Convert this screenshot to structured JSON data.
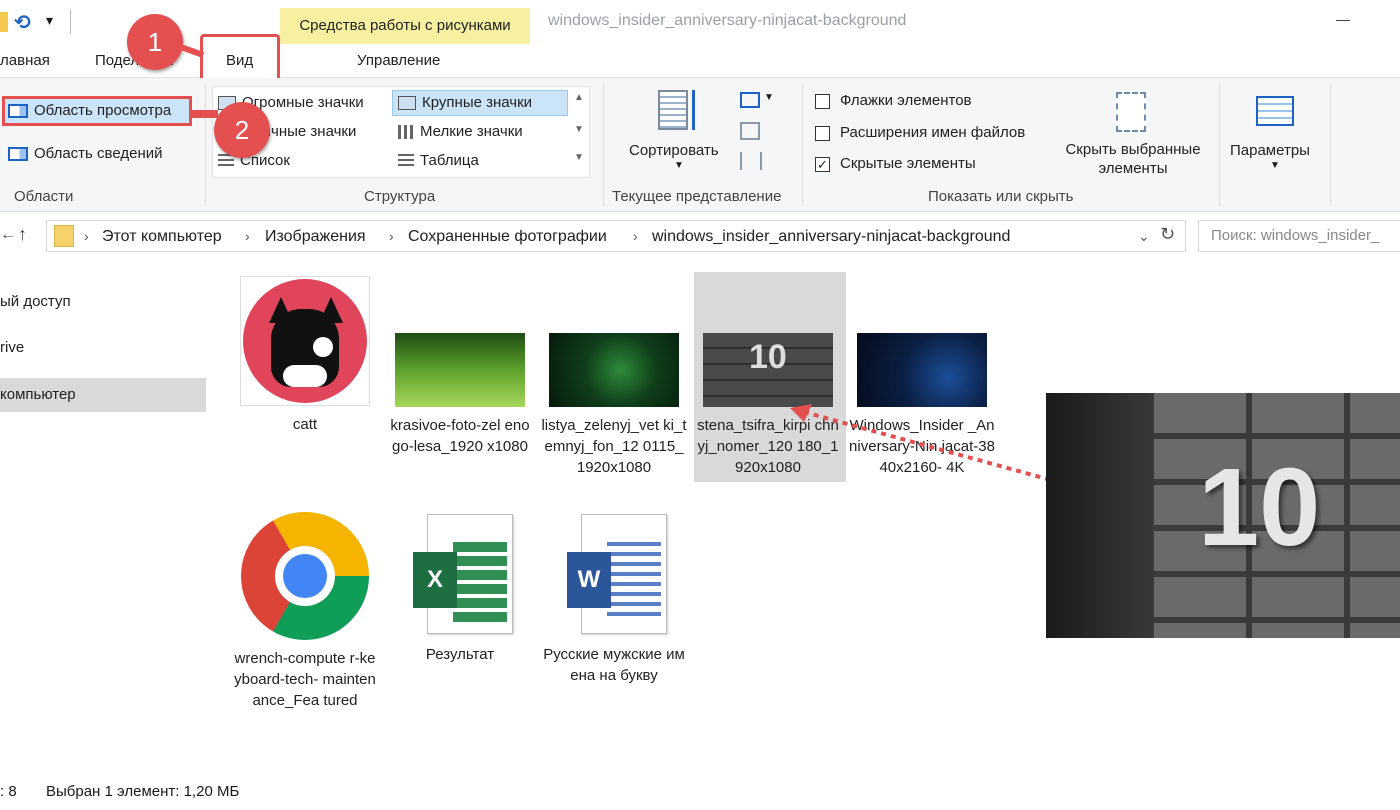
{
  "titlebar": {
    "context_tab": "Средства работы с рисунками",
    "window_title": "windows_insider_anniversary-ninjacat-background"
  },
  "tabs": {
    "home": "лавная",
    "share": "Подел   ться",
    "view": "Вид",
    "manage": "Управление"
  },
  "ribbon": {
    "panes": {
      "preview": "Область просмотра",
      "details": "Область сведений",
      "label": "Области"
    },
    "layout": {
      "huge": "Огромные значки",
      "large": "Крупные значки",
      "normal": "Обычные значки",
      "small": "Мелкие значки",
      "list": "Список",
      "table": "Таблица",
      "label": "Структура"
    },
    "current": {
      "sort": "Сортировать",
      "label": "Текущее представление"
    },
    "show": {
      "checkboxes": "Флажки элементов",
      "extensions": "Расширения имен файлов",
      "hidden": "Скрытые элементы",
      "hide_selected_line1": "Скрыть выбранные",
      "hide_selected_line2": "элементы",
      "label": "Показать или скрыть"
    },
    "options": "Параметры"
  },
  "annotations": {
    "badge1": "1",
    "badge2": "2"
  },
  "address": {
    "crumbs": [
      "Этот компьютер",
      "Изображения",
      "Сохраненные фотографии",
      "windows_insider_anniversary-ninjacat-background"
    ],
    "search_placeholder": "Поиск: windows_insider_"
  },
  "nav": {
    "quick": "ый доступ",
    "onedrive": "rive",
    "thispc": "компьютер"
  },
  "files": [
    {
      "name": "catt"
    },
    {
      "name": "krasivoe-foto-zel enogo-lesa_1920 x1080"
    },
    {
      "name": "listya_zelenyj_vet ki_temnyj_fon_12 0115_1920x1080"
    },
    {
      "name": "stena_tsifra_kirpi chnyj_nomer_120 180_1920x1080"
    },
    {
      "name": "Windows_Insider _Anniversary-Nin jacat-3840x2160- 4K"
    },
    {
      "name": "wrench-compute r-keyboard-tech- maintenance_Fea tured"
    },
    {
      "name": "Результат"
    },
    {
      "name": "Русские мужские имена на букву"
    }
  ],
  "thumbs": {
    "brick_number": "10",
    "excel_letter": "X",
    "word_letter": "W"
  },
  "status": {
    "count": ": 8",
    "selected": "Выбран 1 элемент: 1,20 МБ"
  },
  "colors": {
    "accent_red": "#e4504f",
    "selection_blue": "#cce4f7",
    "context_yellow": "#f6f0a0"
  }
}
